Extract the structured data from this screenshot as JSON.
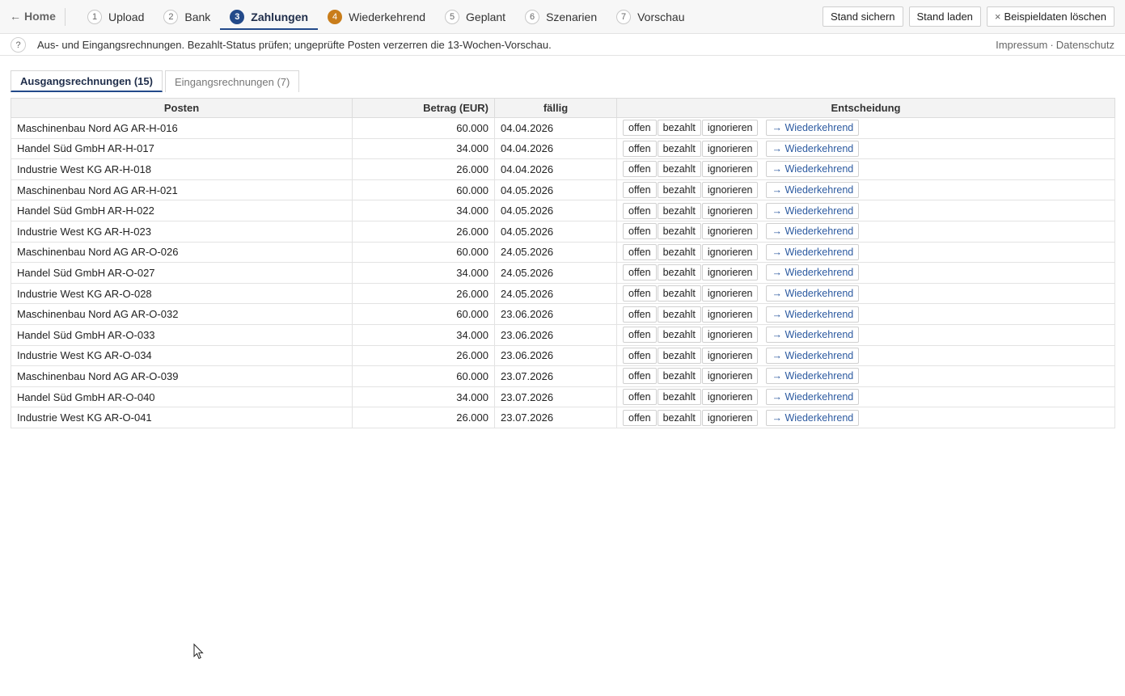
{
  "nav": {
    "home_label": "Home",
    "home_arrow": "←",
    "steps": [
      {
        "num": "1",
        "label": "Upload",
        "state": "normal"
      },
      {
        "num": "2",
        "label": "Bank",
        "state": "normal"
      },
      {
        "num": "3",
        "label": "Zahlungen",
        "state": "active"
      },
      {
        "num": "4",
        "label": "Wiederkehrend",
        "state": "warn"
      },
      {
        "num": "5",
        "label": "Geplant",
        "state": "normal"
      },
      {
        "num": "6",
        "label": "Szenarien",
        "state": "normal"
      },
      {
        "num": "7",
        "label": "Vorschau",
        "state": "normal"
      }
    ],
    "actions": {
      "save": "Stand sichern",
      "load": "Stand laden",
      "clear_icon": "×",
      "clear": "Beispieldaten löschen"
    }
  },
  "info": {
    "help_icon": "?",
    "text": "Aus- und Eingangsrechnungen. Bezahlt-Status prüfen; ungeprüfte Posten verzerren die 13-Wochen-Vorschau.",
    "impressum": "Impressum",
    "separator": "·",
    "datenschutz": "Datenschutz"
  },
  "tabs": {
    "outgoing": "Ausgangsrechnungen (15)",
    "incoming": "Eingangsrechnungen (7)"
  },
  "table": {
    "headers": {
      "item": "Posten",
      "amount": "Betrag (EUR)",
      "due": "fällig",
      "decision": "Entscheidung"
    },
    "decision_labels": {
      "open": "offen",
      "paid": "bezahlt",
      "ignore": "ignorieren",
      "recurring": "→ Wiederkehrend"
    },
    "rows": [
      {
        "item": "Maschinenbau Nord AG AR-H-016",
        "amount": "60.000",
        "due": "04.04.2026"
      },
      {
        "item": "Handel Süd GmbH AR-H-017",
        "amount": "34.000",
        "due": "04.04.2026"
      },
      {
        "item": "Industrie West KG AR-H-018",
        "amount": "26.000",
        "due": "04.04.2026"
      },
      {
        "item": "Maschinenbau Nord AG AR-H-021",
        "amount": "60.000",
        "due": "04.05.2026"
      },
      {
        "item": "Handel Süd GmbH AR-H-022",
        "amount": "34.000",
        "due": "04.05.2026"
      },
      {
        "item": "Industrie West KG AR-H-023",
        "amount": "26.000",
        "due": "04.05.2026"
      },
      {
        "item": "Maschinenbau Nord AG AR-O-026",
        "amount": "60.000",
        "due": "24.05.2026"
      },
      {
        "item": "Handel Süd GmbH AR-O-027",
        "amount": "34.000",
        "due": "24.05.2026"
      },
      {
        "item": "Industrie West KG AR-O-028",
        "amount": "26.000",
        "due": "24.05.2026"
      },
      {
        "item": "Maschinenbau Nord AG AR-O-032",
        "amount": "60.000",
        "due": "23.06.2026"
      },
      {
        "item": "Handel Süd GmbH AR-O-033",
        "amount": "34.000",
        "due": "23.06.2026"
      },
      {
        "item": "Industrie West KG AR-O-034",
        "amount": "26.000",
        "due": "23.06.2026"
      },
      {
        "item": "Maschinenbau Nord AG AR-O-039",
        "amount": "60.000",
        "due": "23.07.2026"
      },
      {
        "item": "Handel Süd GmbH AR-O-040",
        "amount": "34.000",
        "due": "23.07.2026"
      },
      {
        "item": "Industrie West KG AR-O-041",
        "amount": "26.000",
        "due": "23.07.2026"
      }
    ]
  },
  "colors": {
    "accent": "#234a8a",
    "warn": "#c97d1a",
    "link": "#2c5aa0"
  }
}
